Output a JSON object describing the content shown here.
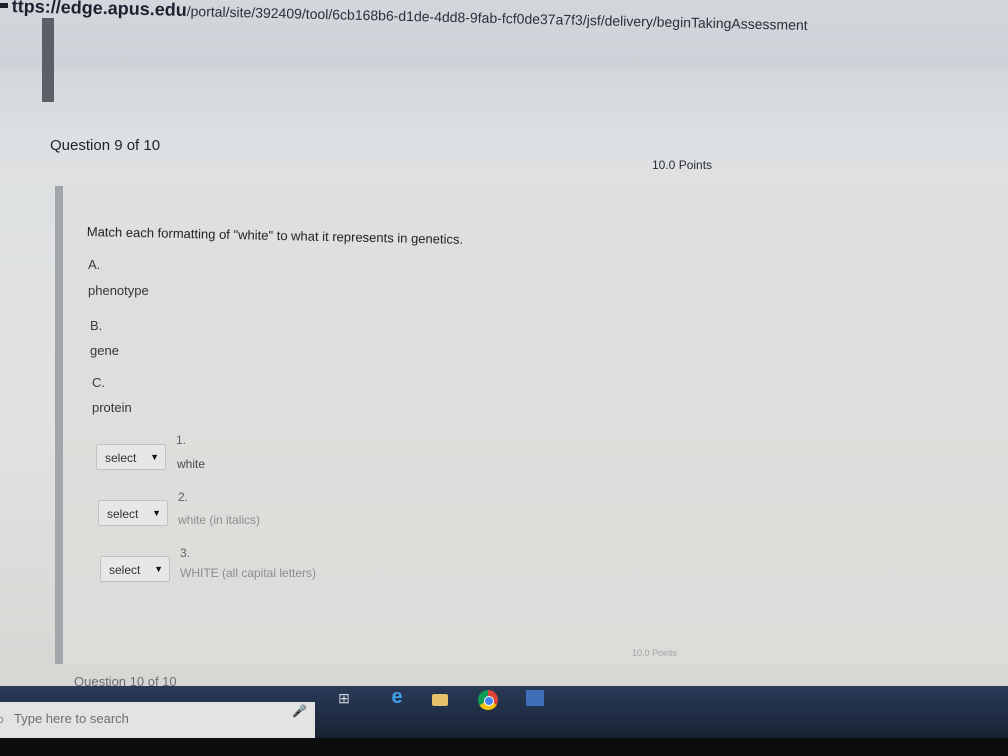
{
  "browser": {
    "url_host": "ttps://edge.apus.edu",
    "url_path": "/portal/site/392409/tool/6cb168b6-d1de-4dd8-9fab-fcf0de37a7f3/jsf/delivery/beginTakingAssessment"
  },
  "question": {
    "title": "Question 9 of 10",
    "points": "10.0 Points",
    "prompt": "Match each formatting of \"white\" to what it represents in genetics.",
    "options": [
      {
        "letter": "A.",
        "label": "phenotype"
      },
      {
        "letter": "B.",
        "label": "gene"
      },
      {
        "letter": "C.",
        "label": "protein"
      }
    ],
    "items": [
      {
        "number": "1.",
        "select_label": "select",
        "text": "white"
      },
      {
        "number": "2.",
        "select_label": "select",
        "text": "white (in italics)"
      },
      {
        "number": "3.",
        "select_label": "select",
        "text": "WHITE (all capital letters)"
      }
    ]
  },
  "next_question": {
    "title": "Question 10 of 10",
    "points": "10.0 Points"
  },
  "taskbar": {
    "search_placeholder": "Type here to search",
    "icons": [
      "search-icon",
      "microphone-icon",
      "task-view-icon",
      "edge-browser-icon",
      "file-explorer-icon",
      "chrome-icon",
      "word-icon"
    ]
  }
}
